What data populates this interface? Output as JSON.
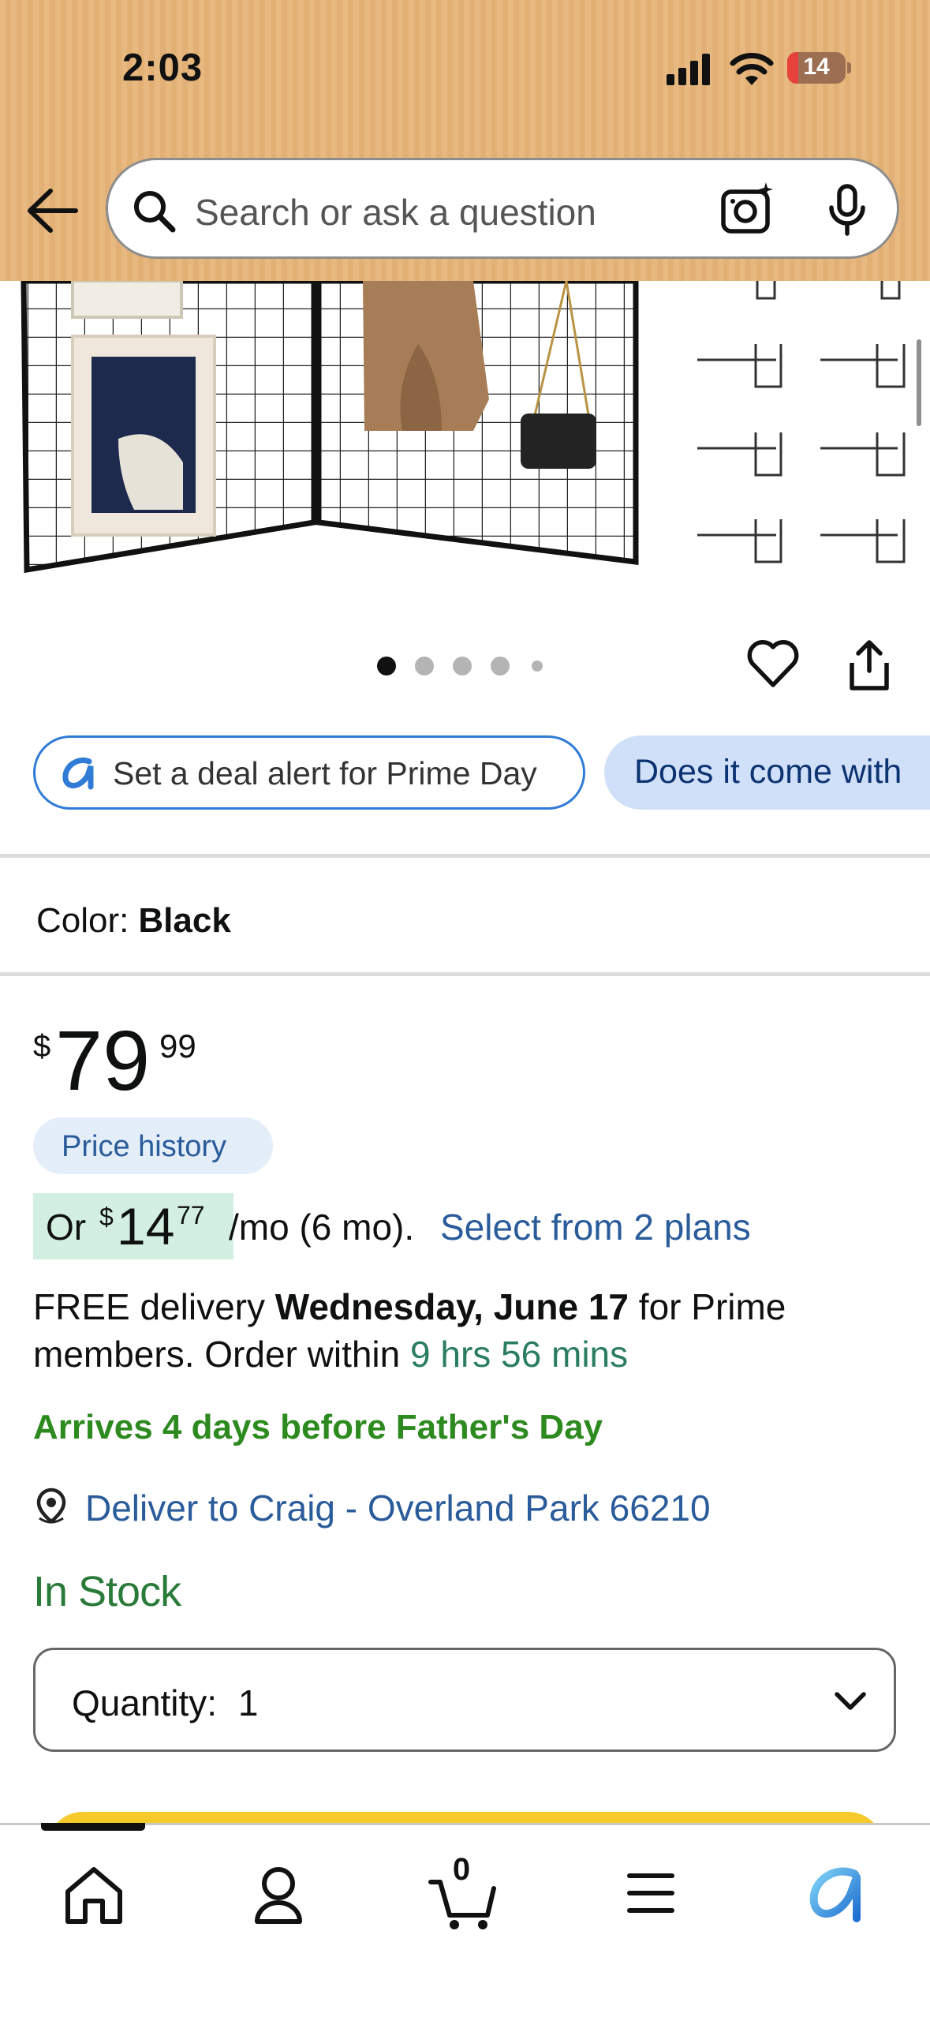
{
  "status_bar": {
    "time": "2:03",
    "battery": "14"
  },
  "search": {
    "placeholder": "Search or ask a question"
  },
  "gallery": {
    "dot_count": 5,
    "active_dot": 0
  },
  "chips": [
    {
      "label": "Set a deal alert for Prime Day"
    },
    {
      "label": "Does it come with"
    }
  ],
  "color": {
    "label": "Color:",
    "value": "Black"
  },
  "price": {
    "currency": "$",
    "whole": "79",
    "fraction": "99"
  },
  "price_history": {
    "label": "Price history"
  },
  "installment": {
    "prefix": "Or",
    "currency": "$",
    "whole": "14",
    "fraction": "77",
    "term": "/mo (6 mo).",
    "link": "Select from 2 plans"
  },
  "delivery": {
    "prefix": "FREE delivery",
    "date": "Wednesday, June 17",
    "suffix": "for Prime members. Order within",
    "countdown": "9 hrs 56 mins"
  },
  "promo_note": "Arrives 4 days before Father's Day",
  "deliver_to": "Deliver to Craig - Overland Park 66210",
  "stock_status": "In Stock",
  "quantity": {
    "label": "Quantity:",
    "value": "1"
  },
  "bottom_nav": {
    "items": [
      "home-icon",
      "account-icon",
      "cart-icon",
      "menu-icon",
      "rufus-icon"
    ],
    "cart_count": "0",
    "active_index": 0
  },
  "colors": {
    "header": "#e7b87f",
    "link": "#2a5b9a",
    "green_promo": "#2d8a1f",
    "in_stock": "#2a7a3a",
    "chip_border": "#2f7bd6",
    "chip_fill": "#cfe0f8",
    "installment_highlight": "#d3efe2",
    "cart_button": "#f7ca2b"
  }
}
